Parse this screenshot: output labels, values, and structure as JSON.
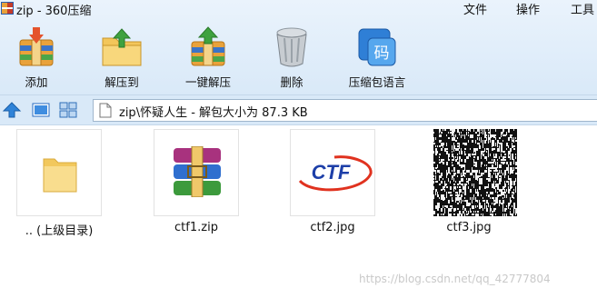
{
  "window": {
    "title": "zip - 360压缩",
    "menu": [
      "文件",
      "操作",
      "工具"
    ]
  },
  "toolbar": {
    "add_label": "添加",
    "extract_to_label": "解压到",
    "one_click_extract_label": "一键解压",
    "delete_label": "删除",
    "language_pack_label": "压缩包语言",
    "language_icon_char": "码"
  },
  "navbar": {
    "address_text": "zip\\怀疑人生 - 解包大小为 87.3 KB"
  },
  "files": [
    {
      "name": ".. (上级目录)",
      "icon": "folder-icon"
    },
    {
      "name": "ctf1.zip",
      "icon": "winrar-archive-icon"
    },
    {
      "name": "ctf2.jpg",
      "icon": "ctf-logo-thumbnail",
      "logo_text": "CTF"
    },
    {
      "name": "ctf3.jpg",
      "icon": "noise-image-thumbnail"
    }
  ],
  "watermark": "https://blog.csdn.net/qq_42777804",
  "colors": {
    "header_bg": "#d9e9f8",
    "logo_blue": "#1d3fa8",
    "logo_red": "#e0321f"
  }
}
